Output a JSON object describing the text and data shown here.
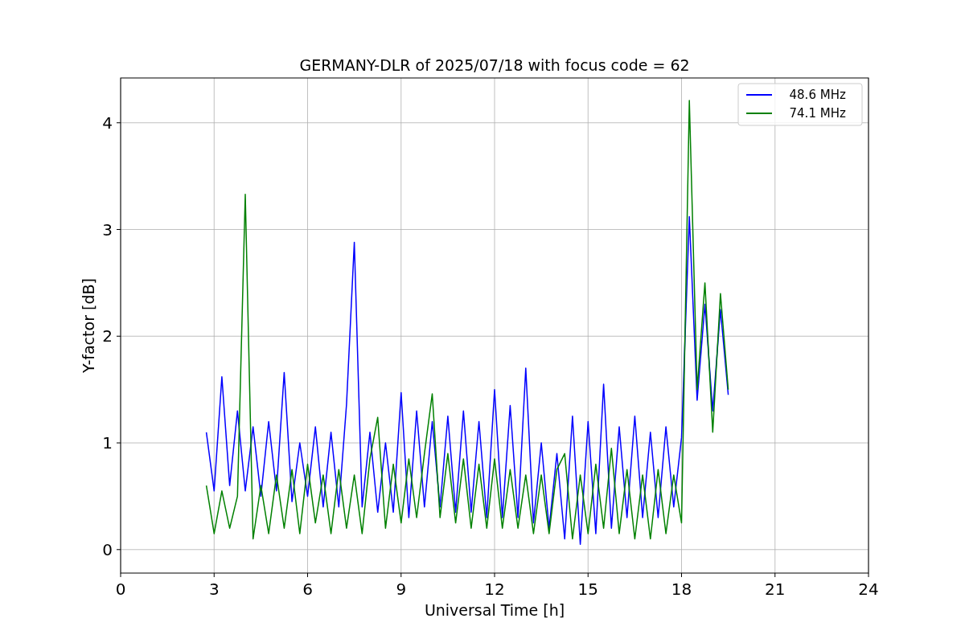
{
  "figure": {
    "chart_data": {
      "type": "line",
      "title": "GERMANY-DLR of 2025/07/18 with focus code = 62",
      "xlabel": "Universal Time [h]",
      "ylabel": "Y-factor [dB]",
      "xlim": [
        0,
        24
      ],
      "ylim": [
        -0.22,
        4.42
      ],
      "xticks": [
        0,
        3,
        6,
        9,
        12,
        15,
        18,
        21,
        24
      ],
      "yticks": [
        0,
        1,
        2,
        3,
        4
      ],
      "grid": true,
      "legend": true,
      "x": [
        2.75,
        3.0,
        3.25,
        3.5,
        3.75,
        4.0,
        4.25,
        4.5,
        4.75,
        5.0,
        5.25,
        5.5,
        5.75,
        6.0,
        6.25,
        6.5,
        6.75,
        7.0,
        7.25,
        7.5,
        7.75,
        8.0,
        8.25,
        8.5,
        8.75,
        9.0,
        9.25,
        9.5,
        9.75,
        10.0,
        10.25,
        10.5,
        10.75,
        11.0,
        11.25,
        11.5,
        11.75,
        12.0,
        12.25,
        12.5,
        12.75,
        13.0,
        13.25,
        13.5,
        13.75,
        14.0,
        14.25,
        14.5,
        14.75,
        15.0,
        15.25,
        15.5,
        15.75,
        16.0,
        16.25,
        16.5,
        16.75,
        17.0,
        17.25,
        17.5,
        17.75,
        18.0,
        18.25,
        18.5,
        18.75,
        19.0,
        19.25,
        19.5
      ],
      "series": [
        {
          "name": "  48.6 MHz",
          "color": "#0000ff",
          "values": [
            1.1,
            0.55,
            1.62,
            0.6,
            1.3,
            0.55,
            1.15,
            0.5,
            1.2,
            0.55,
            1.66,
            0.45,
            1.0,
            0.5,
            1.15,
            0.4,
            1.1,
            0.4,
            1.36,
            2.88,
            0.4,
            1.1,
            0.35,
            1.0,
            0.35,
            1.47,
            0.3,
            1.3,
            0.4,
            1.2,
            0.4,
            1.25,
            0.35,
            1.3,
            0.35,
            1.2,
            0.3,
            1.5,
            0.3,
            1.35,
            0.3,
            1.7,
            0.25,
            1.0,
            0.2,
            0.9,
            0.1,
            1.25,
            0.05,
            1.2,
            0.15,
            1.55,
            0.2,
            1.15,
            0.3,
            1.25,
            0.3,
            1.1,
            0.3,
            1.15,
            0.4,
            1.05,
            3.12,
            1.4,
            2.3,
            1.3,
            2.25,
            1.45
          ]
        },
        {
          "name": "  74.1 MHz",
          "color": "#008000",
          "values": [
            0.6,
            0.15,
            0.55,
            0.2,
            0.5,
            3.33,
            0.1,
            0.6,
            0.15,
            0.7,
            0.2,
            0.75,
            0.15,
            0.8,
            0.25,
            0.7,
            0.15,
            0.75,
            0.2,
            0.7,
            0.15,
            0.85,
            1.24,
            0.2,
            0.8,
            0.25,
            0.85,
            0.3,
            0.9,
            1.46,
            0.3,
            0.9,
            0.25,
            0.85,
            0.2,
            0.8,
            0.2,
            0.85,
            0.2,
            0.75,
            0.2,
            0.7,
            0.15,
            0.7,
            0.15,
            0.75,
            0.9,
            0.1,
            0.7,
            0.15,
            0.8,
            0.2,
            0.95,
            0.15,
            0.75,
            0.1,
            0.7,
            0.1,
            0.75,
            0.15,
            0.7,
            0.25,
            4.21,
            1.5,
            2.5,
            1.1,
            2.4,
            1.5
          ]
        }
      ]
    }
  }
}
